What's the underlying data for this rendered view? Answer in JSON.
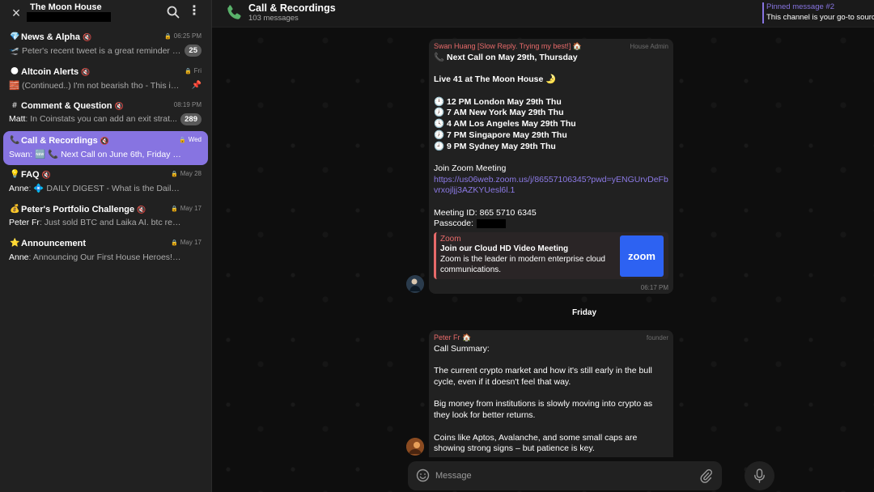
{
  "sidebar": {
    "title": "The Moon House",
    "close_icon": "×",
    "menu_icon": "⋮",
    "chats": [
      {
        "icon": "💎",
        "name": "News & Alpha",
        "time": "06:25 PM",
        "sender": "",
        "preview": "🛫 Peter's recent tweet is a great reminder o...",
        "badge": "25"
      },
      {
        "icon": "🌑",
        "name": "Altcoin Alerts",
        "time": "Fri",
        "sender": "",
        "preview": "🧱 (Continued..) I'm not bearish tho - This is ...",
        "badge": ""
      },
      {
        "icon": "#",
        "name": "Comment & Question",
        "time": "08:19 PM",
        "sender": "Matt",
        "preview": "In Coinstats you can add an exit strat...",
        "badge": "289"
      },
      {
        "icon": "📞",
        "name": "Call & Recordings",
        "time": "Wed",
        "sender": "Swan",
        "preview": "🆕 📞 Next Call on June 6th, Friday Live 4...",
        "badge": ""
      },
      {
        "icon": "💡",
        "name": "FAQ",
        "time": "May 28",
        "sender": "Anne",
        "preview": "💠 DAILY DIGEST - What is the Daily Digest,...",
        "badge": ""
      },
      {
        "icon": "💰",
        "name": "Peter's Portfolio Challenge",
        "time": "May 17",
        "sender": "Peter Fr",
        "preview": "Just sold BTC and Laika AI. btc recover...",
        "badge": ""
      },
      {
        "icon": "⭐",
        "name": "Announcement",
        "time": "May 17",
        "sender": "Anne",
        "preview": "Announcing Our First House Heroes! 🥇 D...",
        "badge": ""
      }
    ],
    "mute_glyph": "🔇",
    "lock_glyph": "🔒",
    "pin_glyph": "📌"
  },
  "chat": {
    "title": "Call & Recordings",
    "subtitle": "103 messages",
    "pinned_title": "Pinned message #2",
    "pinned_text": "This channel is your go-to source"
  },
  "messages": [
    {
      "sender": "Swan Huang [Slow Reply. Trying my best!] 🏠",
      "role": "House Admin",
      "lines": [
        "📞 Next Call on May 29th, Thursday",
        "",
        "Live 41 at The Moon House 🌛",
        "",
        "🕛 12 PM London May 29th Thu",
        "🕖 7 AM New York May 29th Thu",
        "🕓 4 AM Los Angeles May 29th Thu",
        "🕖 7 PM Singapore May 29th Thu",
        "🕘 9 PM Sydney May 29th Thu",
        "",
        "Join Zoom Meeting"
      ],
      "link_line1": "https://us06web.zoom.us/j/86557106345?pwd=yENGUrvDeFb",
      "link_line2": "vrxojljj3AZKYUesl6l.1",
      "meeting_id": "Meeting ID: 865 5710 6345",
      "passcode_label": "Passcode:",
      "preview": {
        "site": "Zoom",
        "title": "Join our Cloud HD Video Meeting",
        "desc": "Zoom is the leader in modern enterprise cloud communications.",
        "logo": "zoom"
      },
      "time": "06:17 PM"
    },
    {
      "sender": "Peter Fr 🏠",
      "role": "founder",
      "lines": [
        "Call Summary:",
        "",
        "The current crypto market and how it's still early in the bull cycle, even if it doesn't feel that way.",
        "",
        "Big money from institutions is slowly moving into crypto as they look for better returns.",
        "",
        "Coins like Aptos, Avalanche, and some small caps are showing strong signs – but patience is key."
      ]
    }
  ],
  "date_separator": "Friday",
  "composer": {
    "placeholder": "Message"
  },
  "colors": {
    "accent": "#8774e1",
    "sender_red": "#e86a6a",
    "link": "#8c7ae6",
    "zoom_blue": "#2d62f2"
  }
}
